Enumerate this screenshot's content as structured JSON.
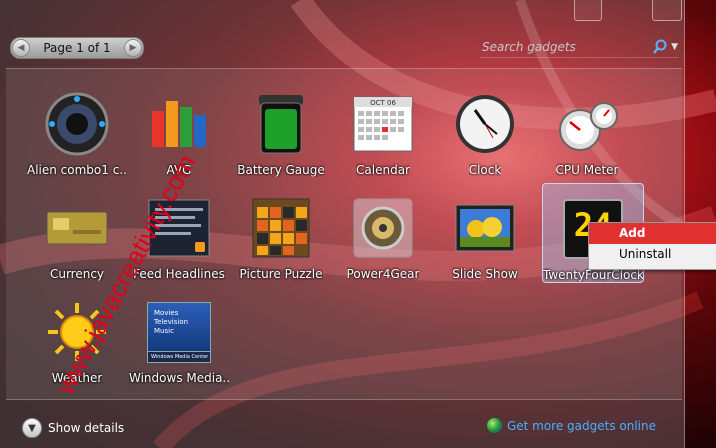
{
  "pager": {
    "text": "Page 1 of 1"
  },
  "search": {
    "placeholder": "Search gadgets"
  },
  "watermark": "www.javacreativity.com",
  "gadgets": [
    {
      "label": "Alien combo1 c...",
      "icon": "alien-icon"
    },
    {
      "label": "AVG",
      "icon": "avg-icon"
    },
    {
      "label": "Battery Gauge",
      "icon": "battery-icon"
    },
    {
      "label": "Calendar",
      "icon": "calendar-icon",
      "month": "OCT 06"
    },
    {
      "label": "Clock",
      "icon": "clock-icon"
    },
    {
      "label": "CPU Meter",
      "icon": "cpu-meter-icon"
    },
    {
      "label": "Currency",
      "icon": "currency-icon"
    },
    {
      "label": "Feed Headlines",
      "icon": "feed-icon"
    },
    {
      "label": "Picture Puzzle",
      "icon": "puzzle-icon"
    },
    {
      "label": "Power4Gear",
      "icon": "power4gear-icon"
    },
    {
      "label": "Slide Show",
      "icon": "slideshow-icon"
    },
    {
      "label": "TwentyFourClock",
      "icon": "twentyfour-clock-icon",
      "digits": "24"
    },
    {
      "label": "Weather",
      "icon": "weather-icon"
    },
    {
      "label": "Windows Media...",
      "icon": "media-center-icon",
      "menu": [
        "Movies",
        "Television",
        "Music"
      ],
      "footer": "Windows Media Center"
    }
  ],
  "context_menu": {
    "items": [
      "Add",
      "Uninstall"
    ]
  },
  "footer": {
    "details_label": "Show details",
    "online_link": "Get more gadgets online"
  },
  "colors": {
    "accent_link": "#47b0ff",
    "menu_highlight": "#e03030",
    "watermark": "#e0001a"
  }
}
